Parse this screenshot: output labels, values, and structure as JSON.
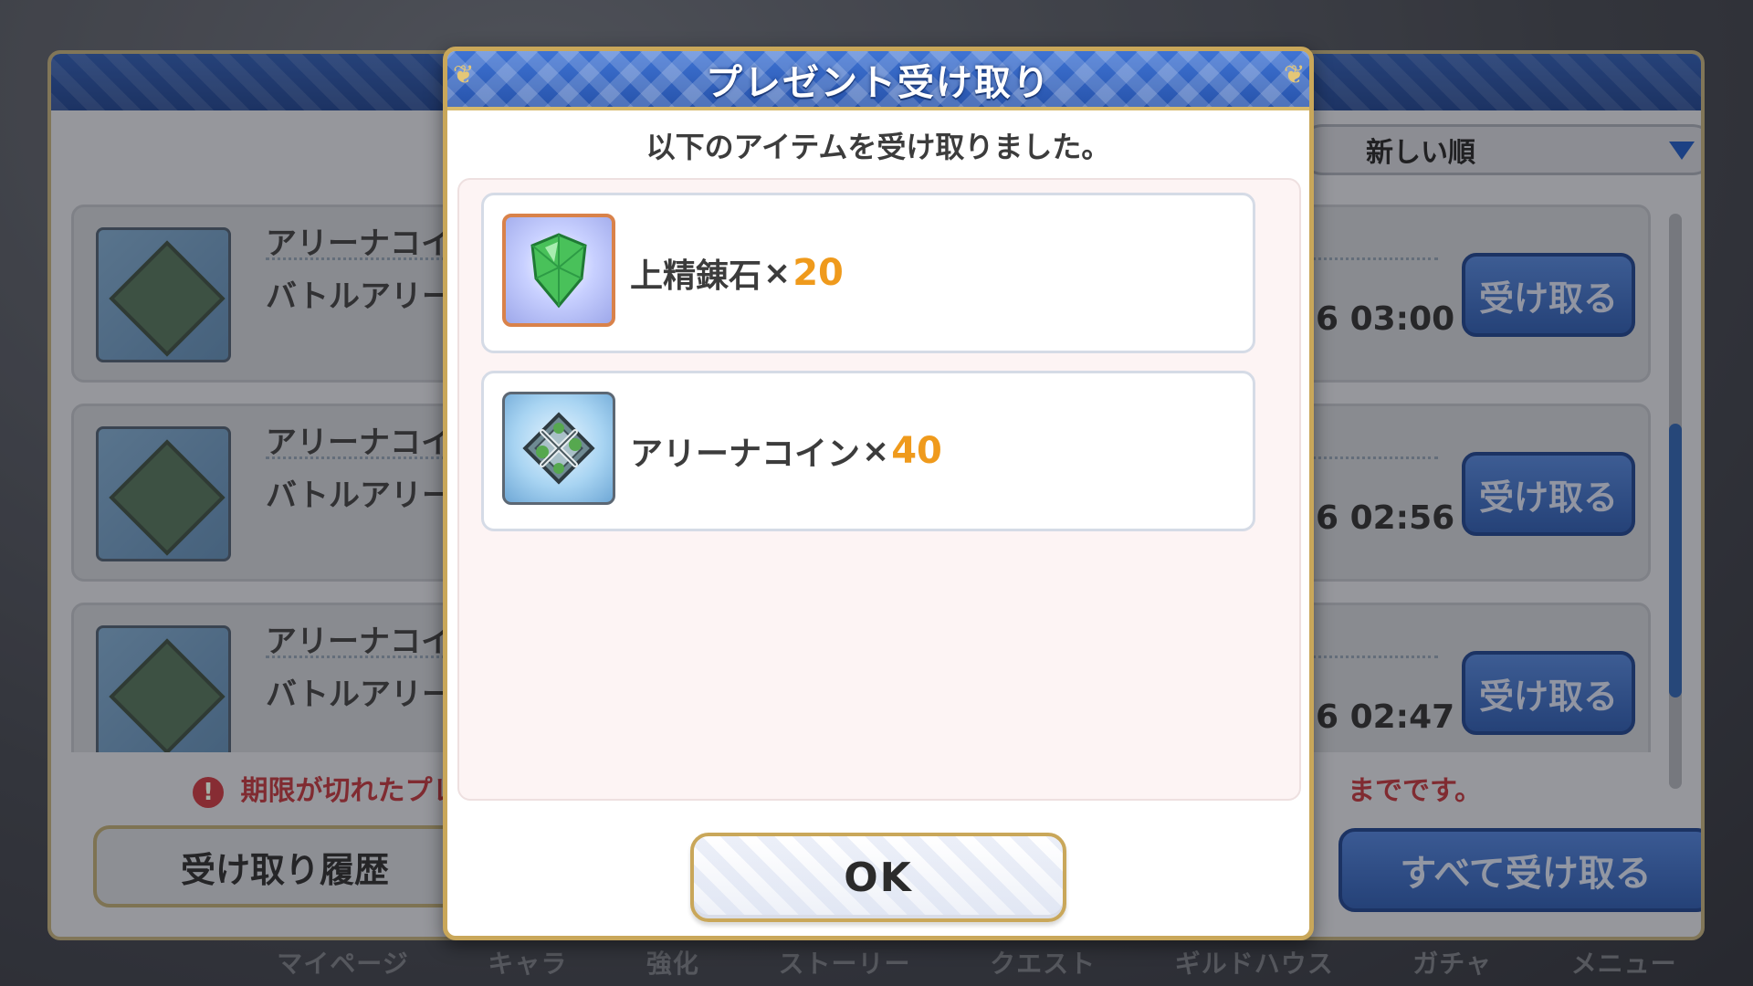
{
  "background": {
    "sort_dropdown": {
      "label": "新しい順",
      "icon": "triangle-down-icon"
    },
    "rows": [
      {
        "name": "アリーナコイ",
        "desc": "バトルアリー",
        "date": "6 03:00",
        "button": "受け取る",
        "icon": "arena-coin-icon"
      },
      {
        "name": "アリーナコイ",
        "desc": "バトルアリー",
        "date": "6 02:56",
        "button": "受け取る",
        "icon": "arena-coin-icon"
      },
      {
        "name": "アリーナコイ",
        "desc": "バトルアリー",
        "date": "6 02:47",
        "button": "受け取る",
        "icon": "arena-coin-icon"
      }
    ],
    "expire_note_left": "期限が切れたプレ",
    "expire_note_right": "までです。",
    "history_button": "受け取り履歴",
    "receive_all_button": "すべて受け取る",
    "bottom_nav": [
      "マイページ",
      "キャラ",
      "強化",
      "ストーリー",
      "クエスト",
      "ギルドハウス",
      "ガチャ",
      "メニュー"
    ]
  },
  "modal": {
    "title": "プレゼント受け取り",
    "message": "以下のアイテムを受け取りました。",
    "items": [
      {
        "name": "上精錬石",
        "times": "×",
        "quantity": "20",
        "icon": "refining-stone-gem-icon"
      },
      {
        "name": "アリーナコイン",
        "times": "×",
        "quantity": "40",
        "icon": "arena-coin-icon"
      }
    ],
    "ok_button": "OK"
  },
  "colors": {
    "header_blue": "#2f60bd",
    "gold_border": "#c9a75a",
    "quantity_orange": "#ef9a1c",
    "panel_pink": "#fdf4f4",
    "warning_red": "#b6333a"
  }
}
